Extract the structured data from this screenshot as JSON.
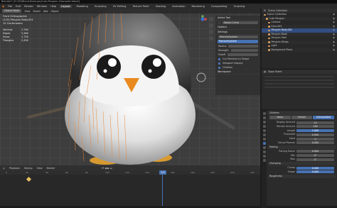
{
  "window": {
    "title": "Blender* [D:\\3D\\Blend-Backups\\Cute-Penguin-Character.blend]"
  },
  "menu": {
    "items": [
      "File",
      "Edit",
      "Render",
      "Window",
      "Help"
    ],
    "workspaces": [
      "Layout",
      "Modeling",
      "Sculpting",
      "UV Editing",
      "Texture Paint",
      "Shading",
      "Animation",
      "Rendering",
      "Compositing",
      "Scripting"
    ],
    "active_workspace": "Layout"
  },
  "viewport": {
    "header_buttons": [
      "Object Mode",
      "View",
      "Select",
      "Add",
      "Object"
    ],
    "view_name": "Front Orthographic",
    "collection": "(125) Penguin Body.001",
    "units": "10 Centimeters",
    "stats": [
      {
        "key": "Vertices",
        "value": "2,746"
      },
      {
        "key": "Edges",
        "value": "5,468"
      },
      {
        "key": "Faces",
        "value": "2,728"
      },
      {
        "key": "Triangles",
        "value": "5,456"
      }
    ]
  },
  "npanel": {
    "active_tool_title": "Active Tool",
    "select_box": "Select Circle",
    "options_title": "Options",
    "settings_title": "Settings",
    "brush": "ParticleSystem",
    "brush_selected": "ParticleSystem",
    "row_labels": [
      "Radius",
      "Strength",
      "Falloff"
    ],
    "checks": [
      "Cut Particles to Shape",
      "Viewport Display",
      "Children"
    ],
    "workspace_label": "Workspace"
  },
  "outliner": {
    "header": "Scene Collection",
    "items": [
      {
        "label": "Scene Collection",
        "selected": false
      },
      {
        "label": "Cute Penguin",
        "selected": false
      },
      {
        "label": "Camera",
        "selected": false
      },
      {
        "label": "Eyes.001",
        "selected": false
      },
      {
        "label": "Penguin Body.001",
        "selected": true
      },
      {
        "label": "Penguin Beak",
        "selected": false
      },
      {
        "label": "Penguin Feet",
        "selected": false
      },
      {
        "label": "Penguin Wings",
        "selected": false
      },
      {
        "label": "Light",
        "selected": false
      },
      {
        "label": "Background Plane",
        "selected": false
      }
    ]
  },
  "editor2": {
    "header": "Dope Sheet"
  },
  "props": {
    "section_children": "Children",
    "modes": [
      "None",
      "Simple",
      "Interpolated"
    ],
    "active_mode": "Interpolated",
    "rows": [
      {
        "label": "Display Amount",
        "value": "10"
      },
      {
        "label": "Render Amount",
        "value": "100"
      },
      {
        "label": "Length",
        "value": "1.000",
        "blue": true
      },
      {
        "label": "Threshold",
        "value": "0.000"
      },
      {
        "label": "Seed",
        "value": "0"
      },
      {
        "label": "Virtual Parents",
        "value": "0.000"
      }
    ],
    "section_parting": "Parting",
    "parting_rows": [
      {
        "label": "Parting Factor",
        "value": "0.000"
      },
      {
        "label": "Min",
        "value": "0°"
      },
      {
        "label": "Max",
        "value": "0°"
      }
    ],
    "section_clumping": "Clumping",
    "clump_rows": [
      {
        "label": "Clump",
        "value": "0.000",
        "blue": true
      },
      {
        "label": "Shape",
        "value": "0.000",
        "blue": true
      }
    ],
    "section_roughness": "Roughness"
  },
  "timeline": {
    "header_items": [
      "Playback",
      "Keying",
      "View",
      "Marker"
    ],
    "ruler_ticks": [
      "0",
      "20",
      "40",
      "60",
      "80",
      "100",
      "120",
      "140",
      "160",
      "180",
      "200",
      "220",
      "240"
    ],
    "current_frame": "125"
  },
  "colors": {
    "accent": "#4772b3",
    "selection": "#e8883a",
    "keyframe": "#e8c060"
  }
}
